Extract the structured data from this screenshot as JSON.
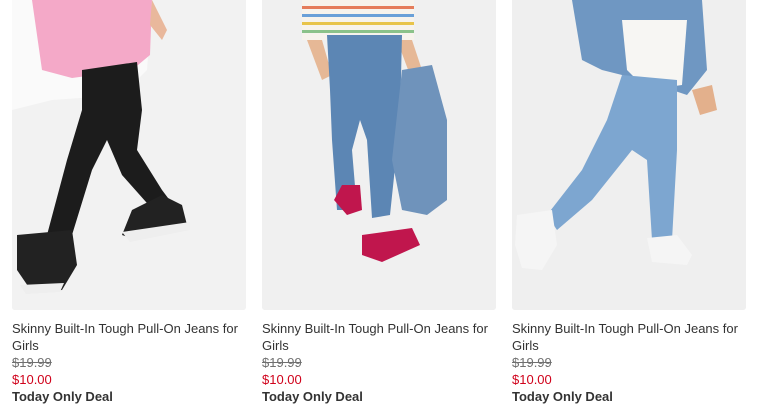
{
  "products": [
    {
      "title": "Skinny Built-In Tough Pull-On Jeans for Girls",
      "was_price": "$19.99",
      "sale_price": "$10.00",
      "deal_label": "Today Only Deal",
      "image": "black-skinny-jeans-photo"
    },
    {
      "title": "Skinny Built-In Tough Pull-On Jeans for Girls",
      "was_price": "$19.99",
      "sale_price": "$10.00",
      "deal_label": "Today Only Deal",
      "image": "medium-wash-skinny-jeans-photo"
    },
    {
      "title": "Skinny Built-In Tough Pull-On Jeans for Girls",
      "was_price": "$19.99",
      "sale_price": "$10.00",
      "deal_label": "Today Only Deal",
      "image": "light-wash-skinny-jeans-photo"
    }
  ],
  "colors": {
    "sale_red": "#d0021b",
    "text_dark": "#333333",
    "text_muted": "#707070",
    "photo_bg": "#f0f0f0"
  }
}
